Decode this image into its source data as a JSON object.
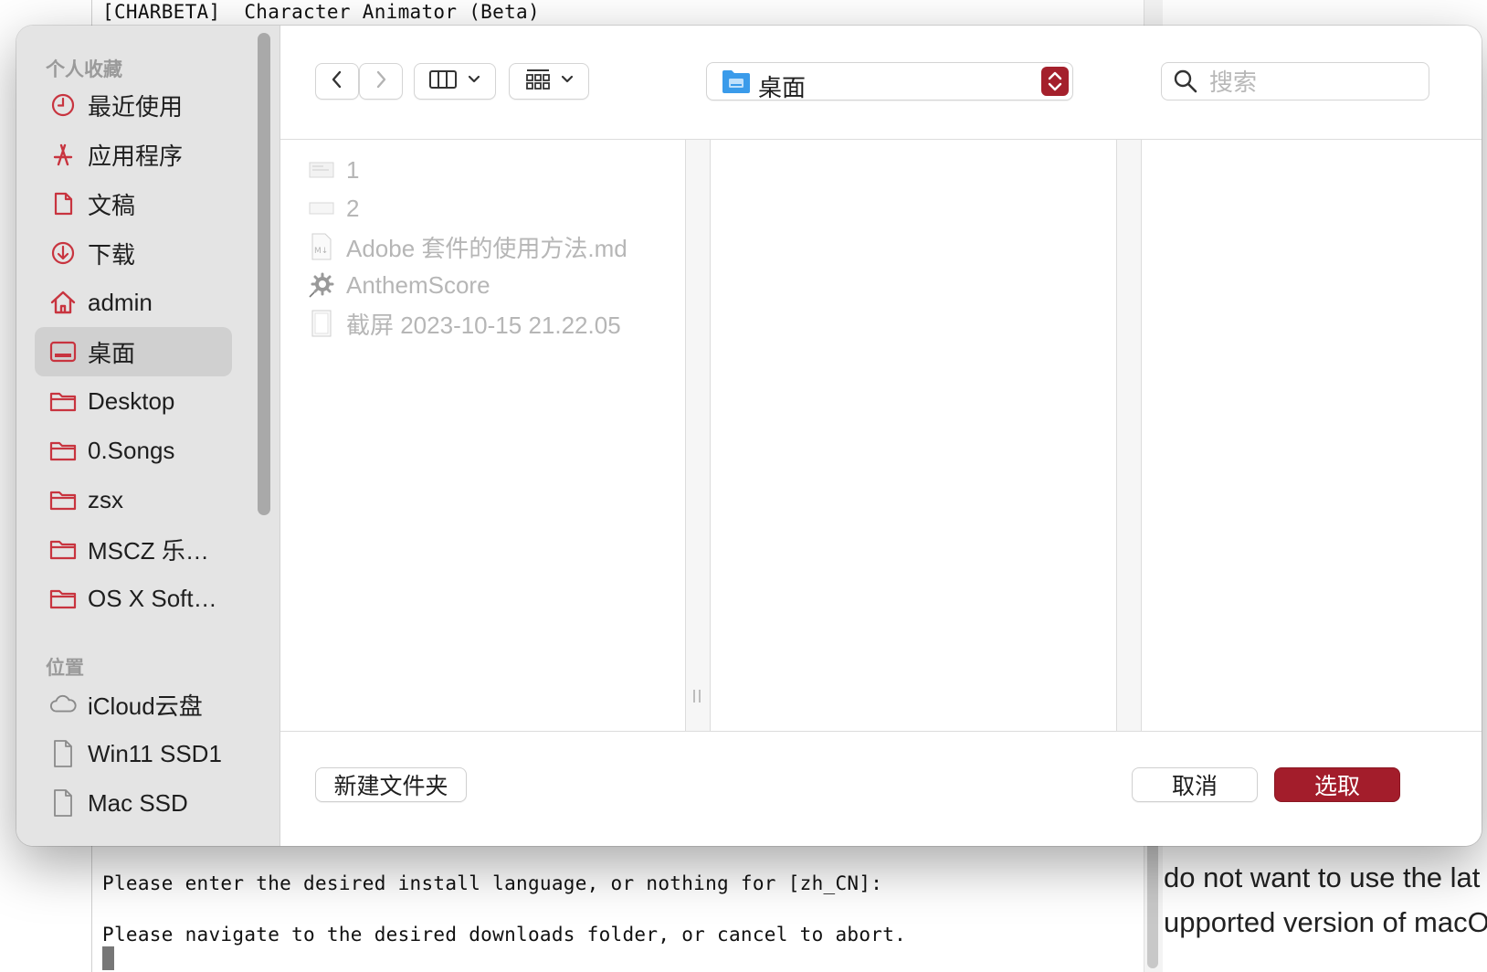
{
  "terminal": {
    "title": "[CHARBETA]  Character Animator (Beta)",
    "lines": [
      "Please enter the desired install language, or nothing for [zh_CN]:",
      "Please navigate to the desired downloads folder, or cancel to abort."
    ]
  },
  "right_doc": {
    "lines": [
      "do not want to use the lat",
      "upported version of macO"
    ]
  },
  "dialog": {
    "sidebar": {
      "favorites_header": "个人收藏",
      "favorites": [
        {
          "label": "最近使用",
          "icon": "clock-icon"
        },
        {
          "label": "应用程序",
          "icon": "applications-icon"
        },
        {
          "label": "文稿",
          "icon": "document-icon"
        },
        {
          "label": "下载",
          "icon": "download-icon"
        },
        {
          "label": "admin",
          "icon": "home-icon"
        },
        {
          "label": "桌面",
          "icon": "desktop-icon",
          "selected": true
        },
        {
          "label": "Desktop",
          "icon": "folder-icon"
        },
        {
          "label": "0.Songs",
          "icon": "folder-icon"
        },
        {
          "label": "zsx",
          "icon": "folder-icon"
        },
        {
          "label": "MSCZ 乐…",
          "icon": "folder-icon"
        },
        {
          "label": "OS X Soft…",
          "icon": "folder-icon"
        }
      ],
      "locations_header": "位置",
      "locations": [
        {
          "label": "iCloud云盘",
          "icon": "cloud-icon"
        },
        {
          "label": "Win11 SSD1",
          "icon": "drive-icon"
        },
        {
          "label": "Mac SSD",
          "icon": "drive-icon"
        }
      ]
    },
    "toolbar": {
      "back_icon": "chevron-left-icon",
      "forward_icon": "chevron-right-icon",
      "view_icon": "columns-view-icon",
      "group_icon": "grid-group-icon",
      "path_label": "桌面",
      "search_placeholder": "搜索"
    },
    "files": [
      {
        "label": "1",
        "icon": "image-file-icon"
      },
      {
        "label": "2",
        "icon": "image-file-icon"
      },
      {
        "label": "Adobe 套件的使用方法.md",
        "icon": "markdown-file-icon"
      },
      {
        "label": "AnthemScore",
        "icon": "app-alias-icon"
      },
      {
        "label": "截屏 2023-10-15 21.22.05",
        "icon": "screenshot-file-icon"
      }
    ],
    "buttons": {
      "new_folder": "新建文件夹",
      "cancel": "取消",
      "choose": "选取"
    },
    "colors": {
      "accent": "#a31d2b",
      "sidebar_icon": "#c8343f"
    }
  }
}
